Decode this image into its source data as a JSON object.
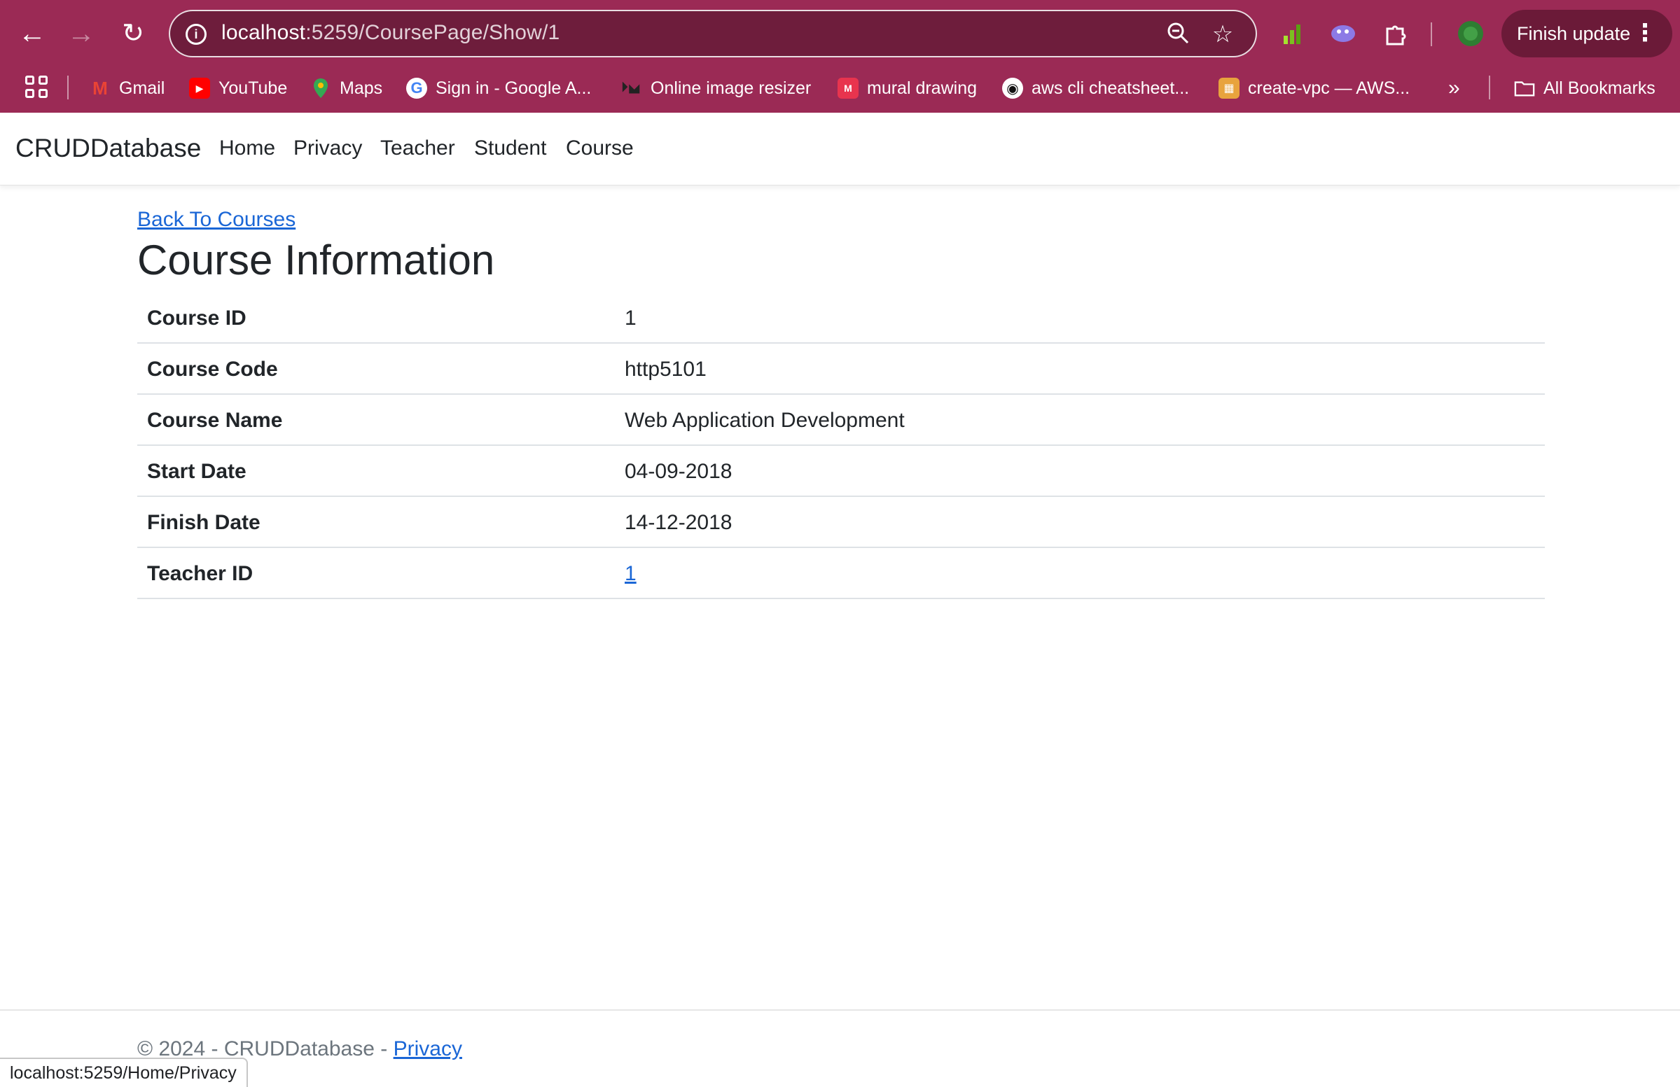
{
  "browser": {
    "url_host": "localhost",
    "url_rest": ":5259/CoursePage/Show/1",
    "finish_update_label": "Finish update",
    "bookmarks": [
      {
        "label": "Gmail",
        "icon": "gmail-icon",
        "color": "#ea4335"
      },
      {
        "label": "YouTube",
        "icon": "youtube-icon",
        "color": "#ff0000"
      },
      {
        "label": "Maps",
        "icon": "maps-icon",
        "color": "#34a853"
      },
      {
        "label": "Sign in - Google A...",
        "icon": "google-icon",
        "color": "#4285f4"
      },
      {
        "label": "Online image resizer",
        "icon": "resizer-icon",
        "color": "#222222"
      },
      {
        "label": "mural drawing",
        "icon": "mural-icon",
        "color": "#e8344e"
      },
      {
        "label": "aws cli cheatsheet...",
        "icon": "github-icon",
        "color": "#111111"
      },
      {
        "label": "create-vpc — AWS...",
        "icon": "aws-box-icon",
        "color": "#e8a33d"
      }
    ],
    "all_bookmarks_label": "All Bookmarks",
    "status_bar_url": "localhost:5259/Home/Privacy"
  },
  "navbar": {
    "brand": "CRUDDatabase",
    "links": [
      "Home",
      "Privacy",
      "Teacher",
      "Student",
      "Course"
    ]
  },
  "main": {
    "back_link": "Back To Courses",
    "title": "Course Information",
    "rows": [
      {
        "label": "Course ID",
        "value": "1",
        "is_link": false
      },
      {
        "label": "Course Code",
        "value": "http5101",
        "is_link": false
      },
      {
        "label": "Course Name",
        "value": "Web Application Development",
        "is_link": false
      },
      {
        "label": "Start Date",
        "value": "04-09-2018",
        "is_link": false
      },
      {
        "label": "Finish Date",
        "value": "14-12-2018",
        "is_link": false
      },
      {
        "label": "Teacher ID",
        "value": "1",
        "is_link": true
      }
    ]
  },
  "footer": {
    "copyright": "© 2024 - CRUDDatabase - ",
    "privacy_link": "Privacy"
  },
  "colors": {
    "chrome_bg": "#9b2a55",
    "link": "#1a66d6",
    "text": "#212529"
  }
}
